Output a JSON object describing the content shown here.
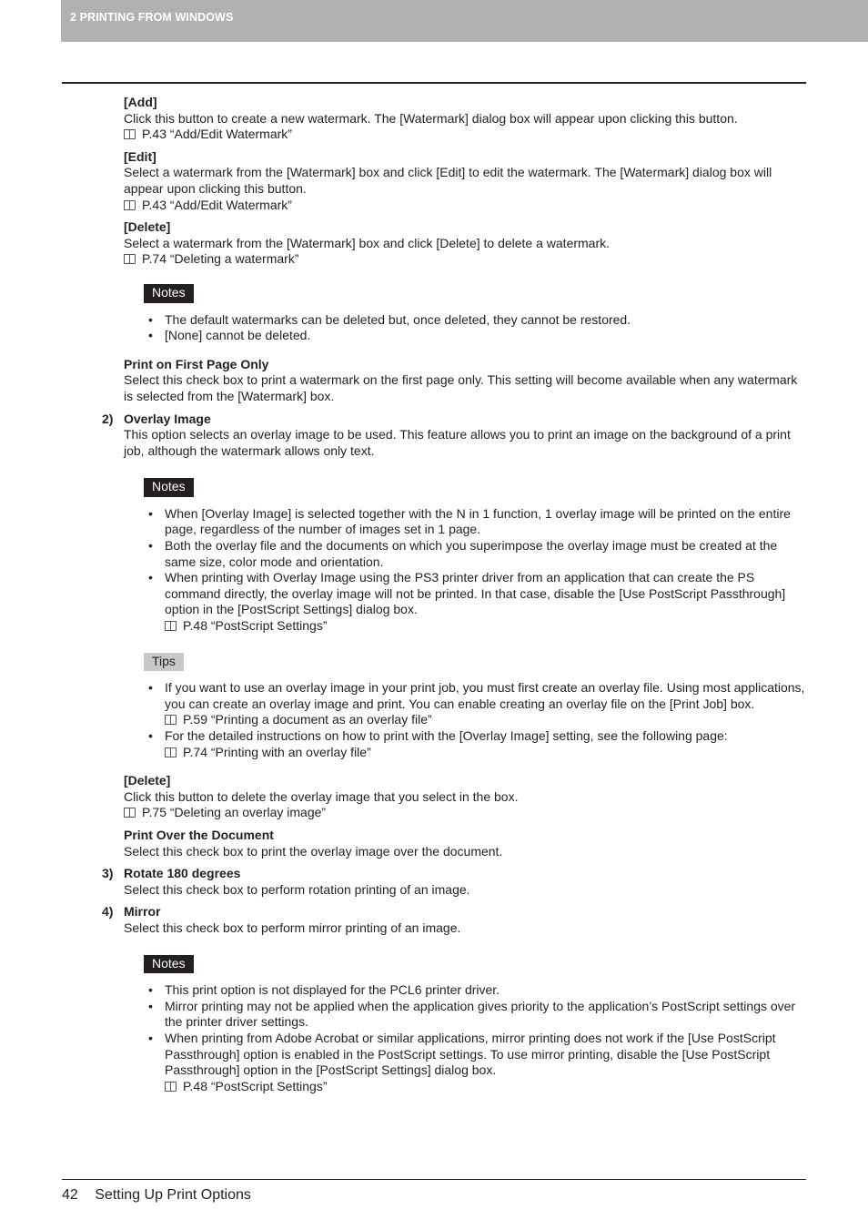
{
  "header": {
    "chapter": "2 PRINTING FROM WINDOWS"
  },
  "sections": {
    "add": {
      "title": "[Add]",
      "body": "Click this button to create a new watermark. The [Watermark] dialog box will appear upon clicking this button.",
      "ref": "P.43 “Add/Edit Watermark”"
    },
    "edit": {
      "title": "[Edit]",
      "body": "Select a watermark from the [Watermark] box and click [Edit] to edit the watermark. The [Watermark] dialog box will appear upon clicking this button.",
      "ref": "P.43 “Add/Edit Watermark”"
    },
    "delete_wm": {
      "title": "[Delete]",
      "body": "Select a watermark from the [Watermark] box and click [Delete] to delete a watermark.",
      "ref": "P.74 “Deleting a watermark”"
    },
    "notes1": {
      "label": "Notes",
      "items": [
        "The default watermarks can be deleted but, once deleted, they cannot be restored.",
        "[None] cannot be deleted."
      ]
    },
    "first_page": {
      "title": "Print on First Page Only",
      "body": "Select this check box to print a watermark on the first page only. This setting will become available when any watermark is selected from the [Watermark] box."
    },
    "overlay": {
      "num": "2)",
      "title": "Overlay Image",
      "body": "This option selects an overlay image to be used. This feature allows you to print an image on the background of a print job, although the watermark allows only text."
    },
    "notes2": {
      "label": "Notes",
      "items": [
        {
          "text": "When [Overlay Image] is selected together with the N in 1 function, 1 overlay image will be printed on the entire page, regardless of the number of images set in 1 page."
        },
        {
          "text": "Both the overlay file and the documents on which you superimpose the overlay image must be created at the same size, color mode and orientation."
        },
        {
          "text": "When printing with Overlay Image using the PS3 printer driver from an application that can create the PS command directly, the overlay image will not be printed. In that case, disable the [Use PostScript Passthrough] option in the [PostScript Settings] dialog box.",
          "ref": "P.48 “PostScript Settings”"
        }
      ]
    },
    "tips": {
      "label": "Tips",
      "items": [
        {
          "text": "If you want to use an overlay image in your print job, you must first create an overlay file. Using most applications, you can create an overlay image and print. You can enable creating an overlay file on the [Print Job] box.",
          "ref": "P.59 “Printing a document as an overlay file”"
        },
        {
          "text": "For the detailed instructions on how to print with the [Overlay Image] setting, see the following page:",
          "ref": "P.74 “Printing with an overlay file”"
        }
      ]
    },
    "delete_ov": {
      "title": "[Delete]",
      "body": "Click this button to delete the overlay image that you select in the box.",
      "ref": "P.75 “Deleting an overlay image”"
    },
    "print_over": {
      "title": "Print Over the Document",
      "body": "Select this check box to print the overlay image over the document."
    },
    "rotate": {
      "num": "3)",
      "title": "Rotate 180 degrees",
      "body": "Select this check box to perform rotation printing of an image."
    },
    "mirror": {
      "num": "4)",
      "title": "Mirror",
      "body": "Select this check box to perform mirror printing of an image."
    },
    "notes3": {
      "label": "Notes",
      "items": [
        {
          "text": "This print option is not displayed for the PCL6 printer driver."
        },
        {
          "text": "Mirror printing may not be applied when the application gives priority to the application’s PostScript settings over the printer driver settings."
        },
        {
          "text": "When printing from Adobe Acrobat or similar applications, mirror printing does not work if the [Use PostScript Passthrough] option is enabled in the PostScript settings. To use mirror printing, disable the [Use PostScript Passthrough] option in the [PostScript Settings] dialog box.",
          "ref": "P.48 “PostScript Settings”"
        }
      ]
    }
  },
  "footer": {
    "page_number": "42",
    "title": "Setting Up Print Options"
  }
}
